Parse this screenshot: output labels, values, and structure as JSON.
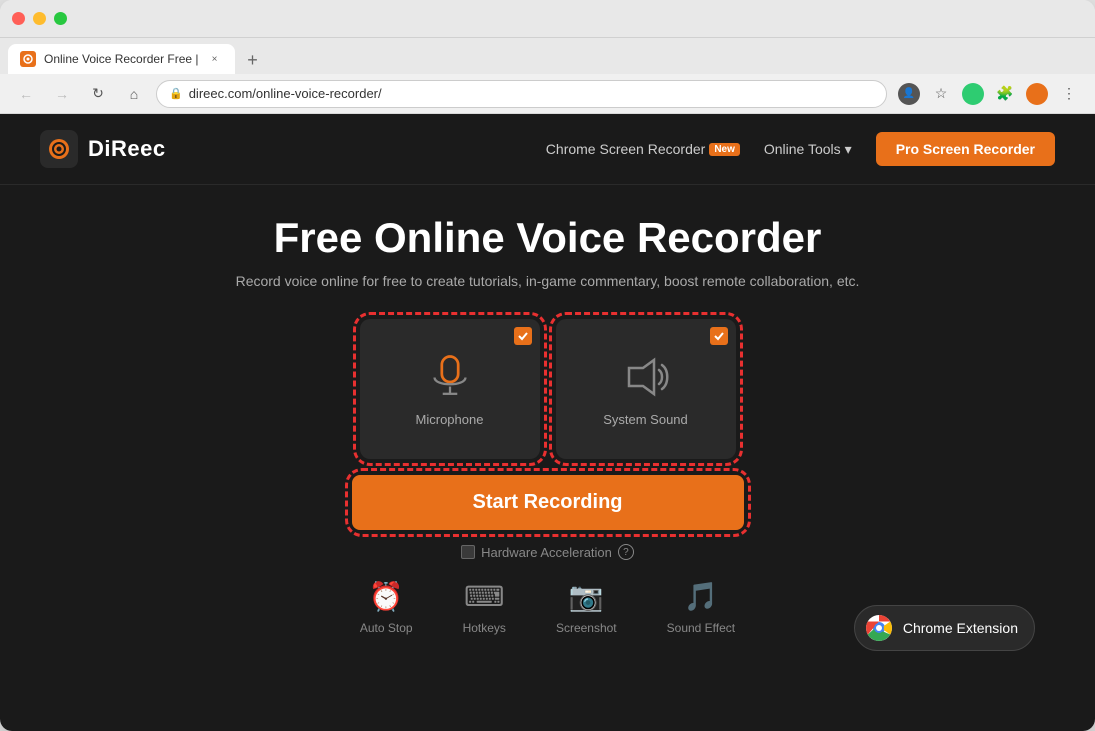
{
  "browser": {
    "tab_title": "Online Voice Recorder Free |",
    "tab_close_label": "×",
    "tab_new_label": "+",
    "address": "direec.com/online-voice-recorder/",
    "nav_back": "←",
    "nav_forward": "→",
    "nav_reload": "↻",
    "nav_home": "⌂"
  },
  "header": {
    "logo_text": "DiReec",
    "nav_screen_recorder": "Chrome Screen Recorder",
    "nav_new_badge": "New",
    "nav_online_tools": "Online Tools",
    "nav_chevron": "▾",
    "pro_btn": "Pro Screen Recorder"
  },
  "main": {
    "title": "Free Online Voice Recorder",
    "subtitle": "Record voice online for free to create tutorials, in-game commentary, boost remote collaboration, etc.",
    "microphone_label": "Microphone",
    "system_sound_label": "System Sound",
    "start_btn": "Start Recording",
    "hw_accel_label": "Hardware Acceleration",
    "chrome_ext_label": "Chrome Extension"
  },
  "bottom_icons": [
    {
      "label": "Auto Stop",
      "icon": "⏰"
    },
    {
      "label": "Hotkeys",
      "icon": "⌨"
    },
    {
      "label": "Screenshot",
      "icon": "📷"
    },
    {
      "label": "Sound Effect",
      "icon": "🎵"
    }
  ]
}
